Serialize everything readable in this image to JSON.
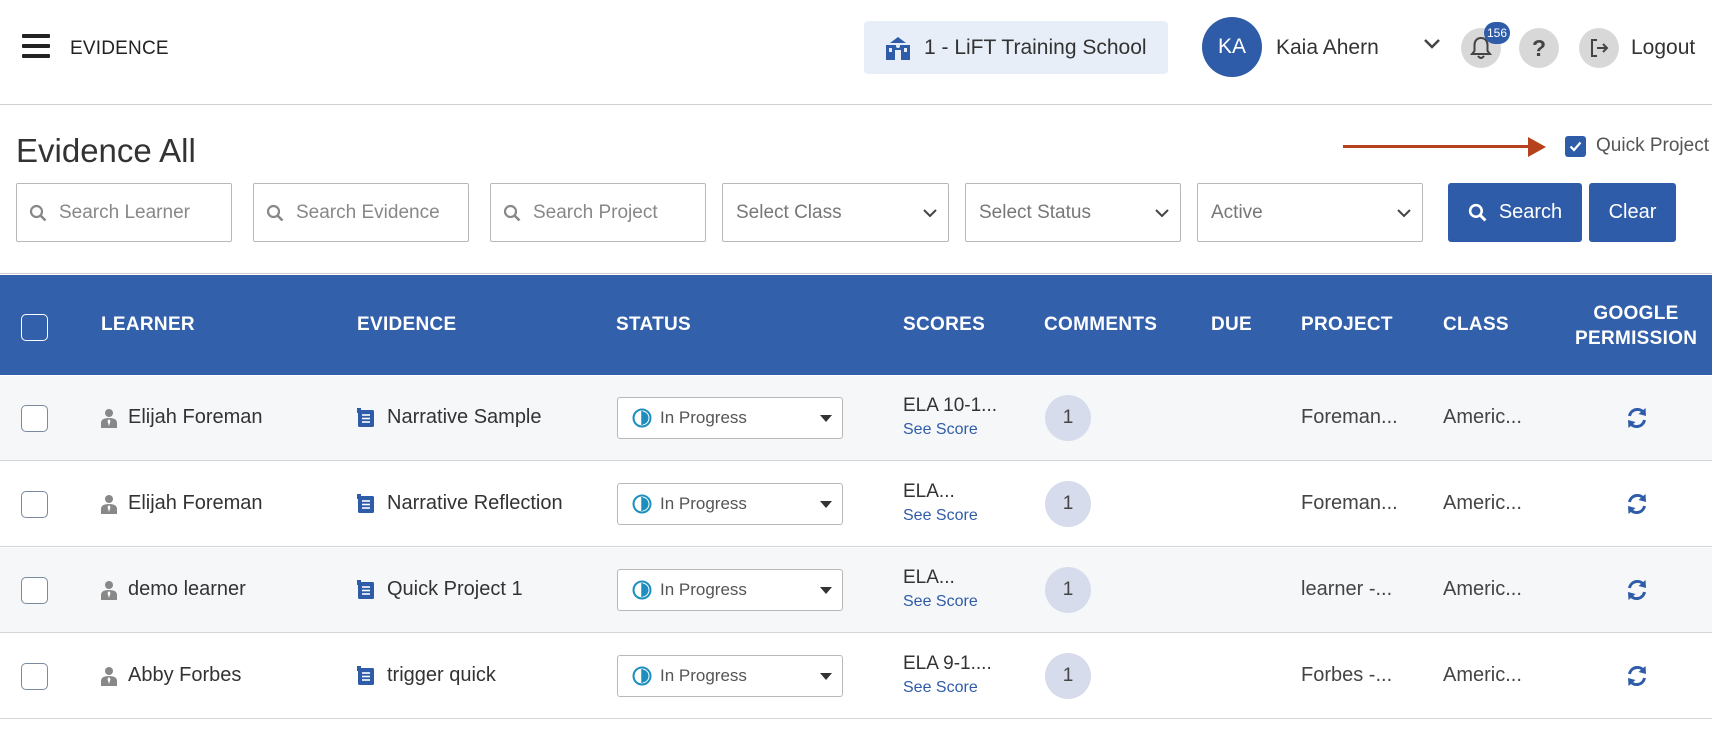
{
  "header": {
    "app_title": "EVIDENCE",
    "school": "1 - LiFT Training School",
    "user_initials": "KA",
    "user_name": "Kaia Ahern",
    "notification_count": "156",
    "help_label": "?",
    "logout_label": "Logout"
  },
  "filters": {
    "page_title": "Evidence All",
    "quick_project_label": "Quick Project",
    "quick_project_checked": true,
    "search_learner_placeholder": "Search Learner",
    "search_evidence_placeholder": "Search Evidence",
    "search_project_placeholder": "Search Project",
    "select_class": "Select Class",
    "select_status": "Select Status",
    "active": "Active",
    "search_button": "Search",
    "clear_button": "Clear"
  },
  "table": {
    "columns": {
      "learner": "LEARNER",
      "evidence": "EVIDENCE",
      "status": "STATUS",
      "scores": "SCORES",
      "comments": "COMMENTS",
      "due": "DUE",
      "project": "PROJECT",
      "class": "CLASS",
      "google_line1": "GOOGLE",
      "google_line2": "PERMISSION"
    },
    "rows": [
      {
        "learner": "Elijah Foreman",
        "evidence": "Narrative Sample",
        "status": "In Progress",
        "score": "ELA 10-1...",
        "see_score": "See Score",
        "comments": "1",
        "due": "",
        "project": "Foreman...",
        "class": "Americ..."
      },
      {
        "learner": "Elijah Foreman",
        "evidence": "Narrative Reflection",
        "status": "In Progress",
        "score": "ELA...",
        "see_score": "See Score",
        "comments": "1",
        "due": "",
        "project": "Foreman...",
        "class": "Americ..."
      },
      {
        "learner": "demo learner",
        "evidence": "Quick Project 1",
        "status": "In Progress",
        "score": "ELA...",
        "see_score": "See Score",
        "comments": "1",
        "due": "",
        "project": "learner -...",
        "class": "Americ..."
      },
      {
        "learner": "Abby Forbes",
        "evidence": "trigger quick",
        "status": "In Progress",
        "score": "ELA 9-1....",
        "see_score": "See Score",
        "comments": "1",
        "due": "",
        "project": "Forbes -...",
        "class": "Americ..."
      }
    ]
  },
  "colors": {
    "primary": "#2f5ca8",
    "header_row": "#3360aa",
    "annotation_arrow": "#b5421c"
  }
}
